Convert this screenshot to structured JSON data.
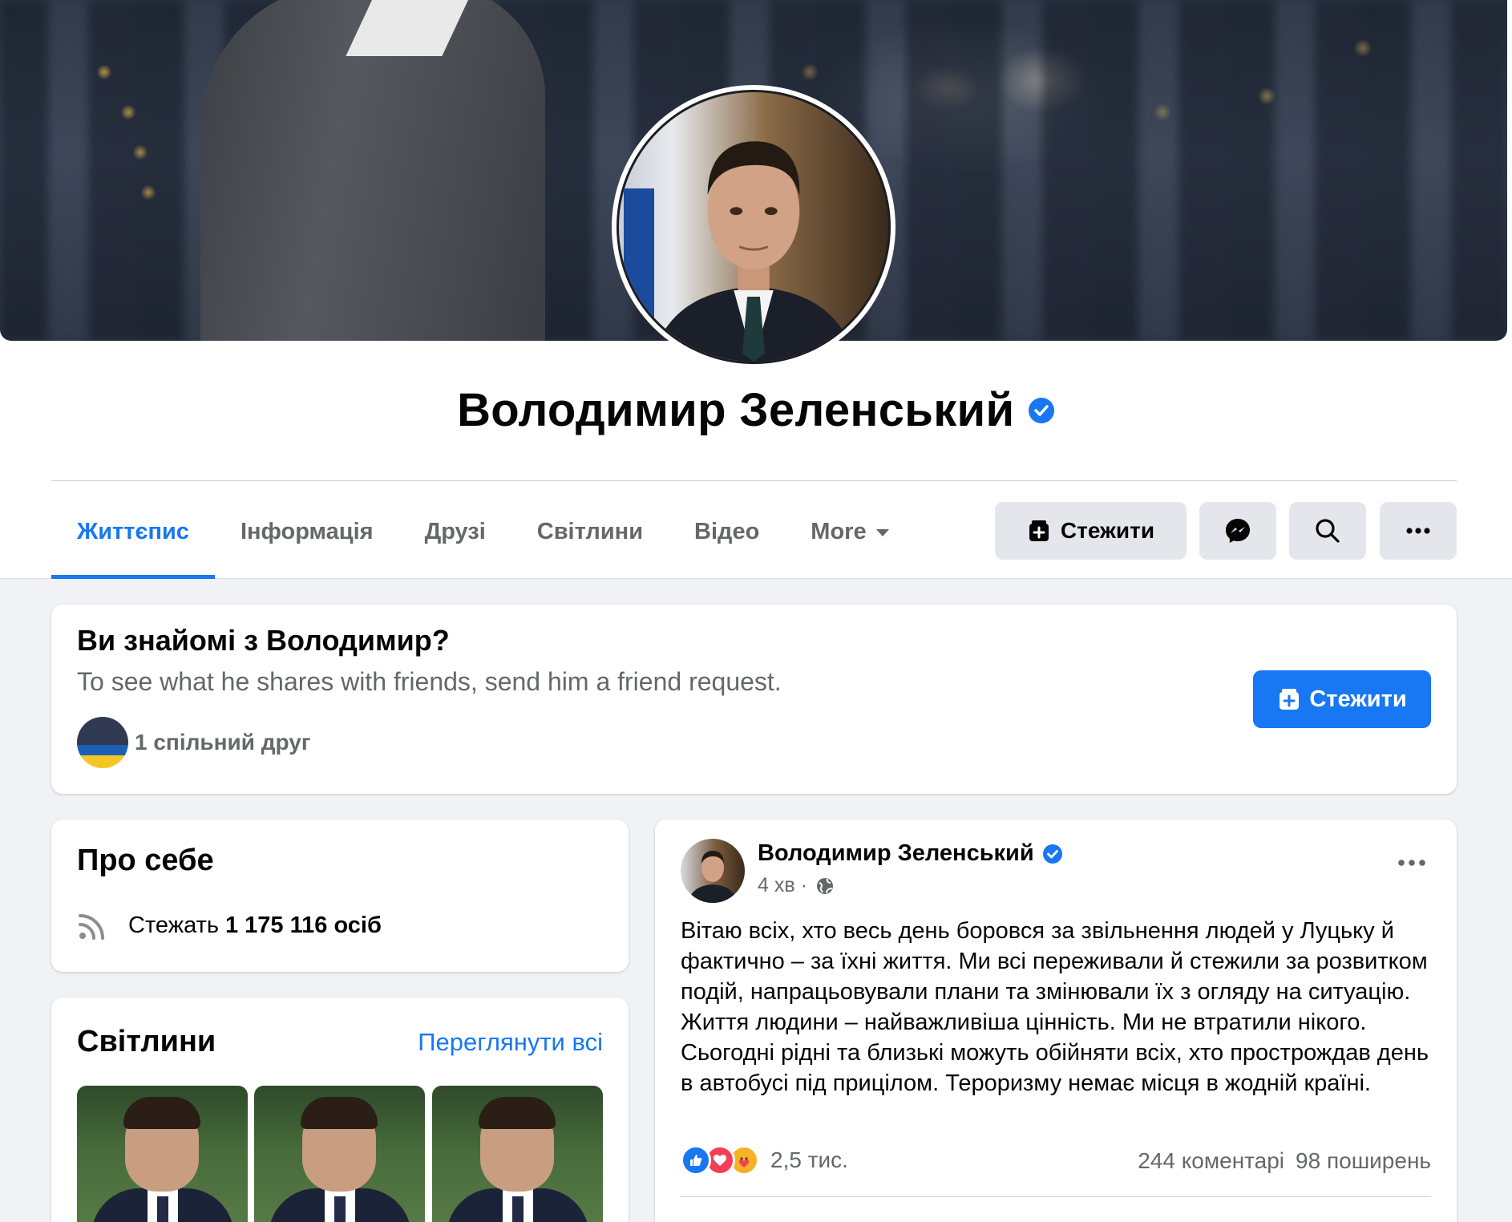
{
  "profile": {
    "name": "Володимир Зеленський",
    "verified": true
  },
  "tabs": [
    {
      "label": "Життєпис",
      "active": true
    },
    {
      "label": "Інформація",
      "active": false
    },
    {
      "label": "Друзі",
      "active": false
    },
    {
      "label": "Світлини",
      "active": false
    },
    {
      "label": "Відео",
      "active": false
    },
    {
      "label": "More",
      "active": false
    }
  ],
  "actions": {
    "follow_label": "Стежити",
    "messenger_icon": "messenger-icon",
    "search_icon": "search-icon",
    "more_icon": "more-icon"
  },
  "know_card": {
    "title": "Ви знайомі з Володимир?",
    "subtitle": "To see what he shares with friends, send him a friend request.",
    "mutual_friends": "1 спільний друг",
    "follow_label": "Стежити"
  },
  "about": {
    "title": "Про себе",
    "followers_prefix": "Стежать",
    "followers_count": "1 175 116 осіб"
  },
  "photos": {
    "title": "Світлини",
    "see_all": "Переглянути всі"
  },
  "post": {
    "author": "Володимир Зеленський",
    "time": "4 хв ·",
    "text": "Вітаю всіх, хто весь день боровся за звільнення людей у Луцьку й фактично – за їхні життя. Ми всі переживали й стежили за розвитком подій, напрацьовували плани та змінювали їх з огляду на ситуацію. Життя людини – найважливіша цінність. Ми не втратили нікого. Сьогодні рідні та близькі можуть обійняти всіх, хто прострождав день в автобусі під прицілом. Тероризму немає місця в жодній країні.",
    "reactions_count": "2,5 тис.",
    "comments": "244 коментарі",
    "shares": "98 поширень"
  },
  "colors": {
    "accent": "#1877f2",
    "secondary_text": "#65676b",
    "background": "#f0f2f5"
  }
}
